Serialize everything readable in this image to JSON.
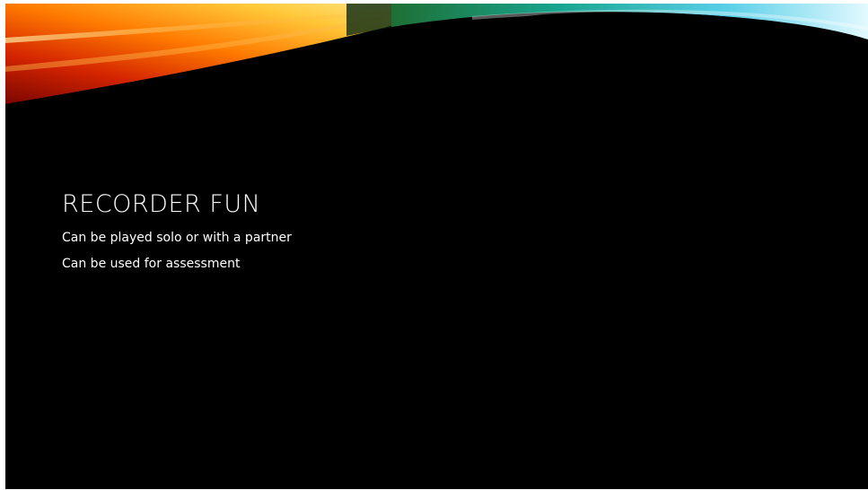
{
  "slide": {
    "title": "RECORDER FUN",
    "bullets": [
      "Can be played solo or with a partner",
      "Can be used for assessment"
    ]
  },
  "colors": {
    "background": "#000000",
    "text": "#ffffff",
    "banner_warm": [
      "#8a0a00",
      "#e23a00",
      "#ff8c00",
      "#ffd54a"
    ],
    "banner_cool": [
      "#1f7a3a",
      "#1fb3a3",
      "#6fd9f0",
      "#d8f7ff"
    ]
  }
}
